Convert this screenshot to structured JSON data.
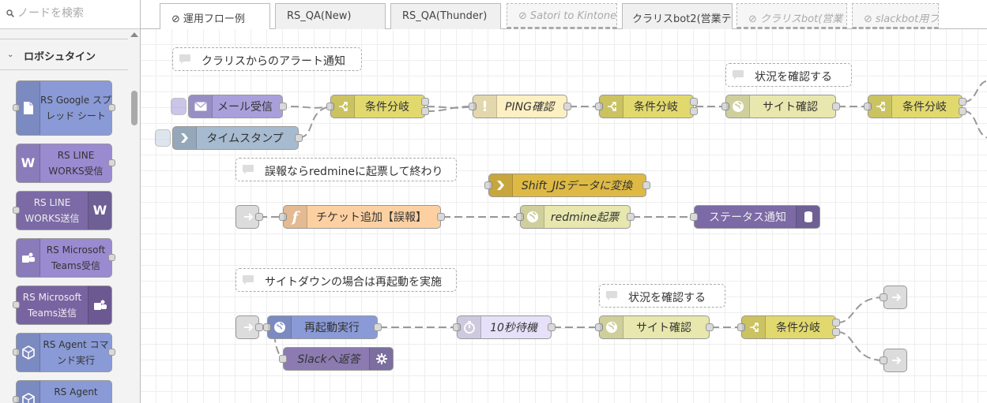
{
  "search": {
    "placeholder": "ノードを検索"
  },
  "palette": {
    "category": "ロボシュタイン",
    "nodes": [
      {
        "label": "RS Google スプレッド シート",
        "icon": "document-icon"
      },
      {
        "label": "RS LINE WORKS受信",
        "icon": "lineworks-icon"
      },
      {
        "label": "RS LINE WORKS送信",
        "icon": "lineworks-icon"
      },
      {
        "label": "RS Microsoft Teams受信",
        "icon": "teams-icon"
      },
      {
        "label": "RS Microsoft Teams送信",
        "icon": "teams-icon"
      },
      {
        "label": "RS Agent コマンド実行",
        "icon": "cube-icon"
      },
      {
        "label": "RS Agent",
        "icon": "cube-icon"
      }
    ]
  },
  "tabs": [
    {
      "label": "運用フロー例",
      "disabled": true,
      "active": true
    },
    {
      "label": "RS_QA(New)",
      "disabled": false
    },
    {
      "label": "RS_QA(Thunder)",
      "disabled": false
    },
    {
      "label": "Satori to Kintone",
      "disabled": true
    },
    {
      "label": "クラリスbot2(営業テ",
      "disabled": false
    },
    {
      "label": "クラリスbot(営業",
      "disabled": true
    },
    {
      "label": "slackbot用フ",
      "disabled": true
    }
  ],
  "flow": {
    "comments": {
      "c1": "クラリスからのアラート通知",
      "c2": "状況を確認する",
      "c3": "誤報ならredmineに起票して終わり",
      "c4": "サイトダウンの場合は再起動を実施",
      "c5": "状況を確認する"
    },
    "nodes": {
      "mail": "メール受信",
      "timestamp": "タイムスタンプ",
      "switch1": "条件分岐",
      "ping": "PING確認",
      "switch2": "条件分岐",
      "site1": "サイト確認",
      "switch3": "条件分岐",
      "sjis": "Shift_JISデータに変換",
      "ticket": "チケット追加【誤報】",
      "redmine": "redmine起票",
      "status": "ステータス通知",
      "restart": "再起動実行",
      "wait": "10秒待機",
      "site2": "サイト確認",
      "switch4": "条件分岐",
      "slack": "Slackへ返答"
    }
  }
}
